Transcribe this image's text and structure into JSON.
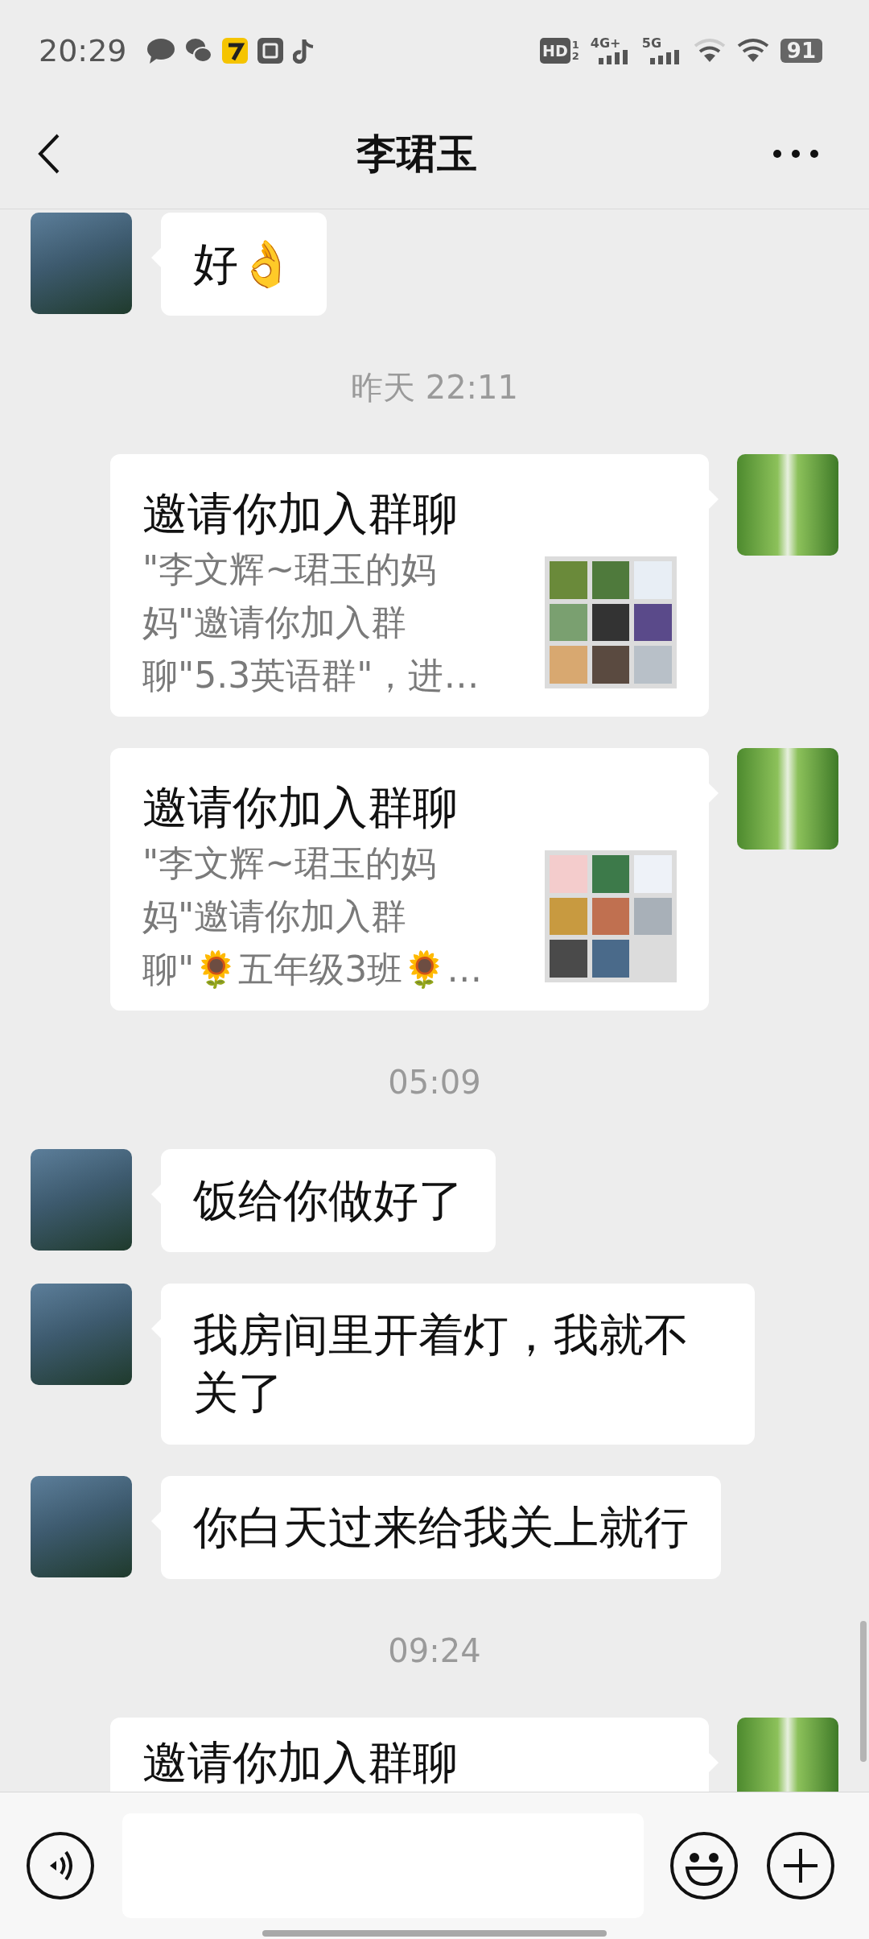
{
  "status_bar": {
    "time": "20:29",
    "hd_label": "HD",
    "sim_labels": [
      "1",
      "2"
    ],
    "networks": [
      {
        "label": "4G+"
      },
      {
        "label": "5G"
      }
    ],
    "battery": "91"
  },
  "header": {
    "title": "李珺玉"
  },
  "messages": [
    {
      "kind": "text",
      "from_me": false,
      "text": "好👌"
    },
    {
      "kind": "time",
      "text": "昨天 22:11"
    },
    {
      "kind": "card",
      "from_me": true,
      "title": "邀请你加入群聊",
      "description_lines": [
        "\"李文辉~珺玉的妈",
        "妈\"邀请你加入群",
        "聊\"5.3英语群\"，进…"
      ]
    },
    {
      "kind": "card",
      "from_me": true,
      "title": "邀请你加入群聊",
      "description_lines": [
        "\"李文辉~珺玉的妈",
        "妈\"邀请你加入群",
        "聊\"🌻五年级3班🌻…"
      ]
    },
    {
      "kind": "time",
      "text": "05:09"
    },
    {
      "kind": "text",
      "from_me": false,
      "text": "饭给你做好了"
    },
    {
      "kind": "text",
      "from_me": false,
      "text": "我房间里开着灯，我就不关了"
    },
    {
      "kind": "text",
      "from_me": false,
      "text": "你白天过来给我关上就行"
    },
    {
      "kind": "time",
      "text": "09:24"
    },
    {
      "kind": "card",
      "from_me": true,
      "title": "邀请你加入群聊"
    }
  ]
}
